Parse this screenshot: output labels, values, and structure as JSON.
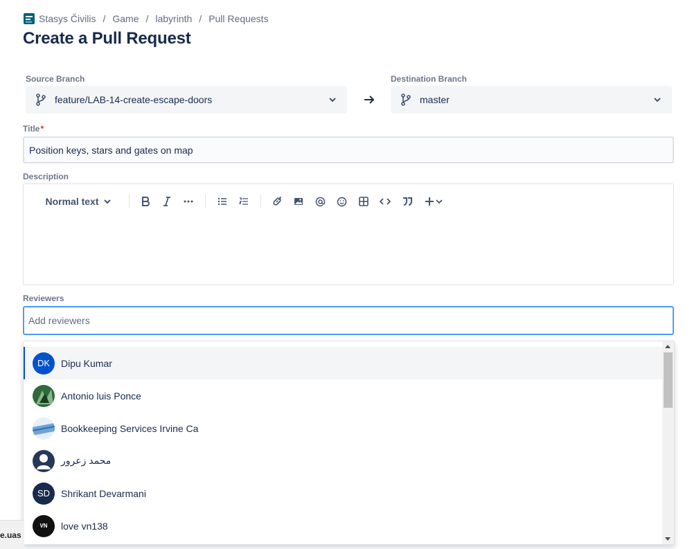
{
  "breadcrumb": {
    "items": [
      "Stasys Čivilis",
      "Game",
      "labyrinth",
      "Pull Requests"
    ],
    "separator": "/"
  },
  "page_title": "Create a Pull Request",
  "source_branch": {
    "label": "Source Branch",
    "value": "feature/LAB-14-create-escape-doors",
    "icon": "branch-icon"
  },
  "destination_branch": {
    "label": "Destination Branch",
    "value": "master",
    "icon": "branch-icon"
  },
  "title_field": {
    "label": "Title",
    "required_mark": "*",
    "value": "Position keys, stars and gates on map"
  },
  "description": {
    "label": "Description",
    "toolbar": {
      "text_style": "Normal text",
      "buttons": [
        "bold-icon",
        "italic-icon",
        "more-formatting-icon",
        "bullet-list-icon",
        "numbered-list-icon",
        "link-icon",
        "image-icon",
        "mention-icon",
        "emoji-icon",
        "table-icon",
        "code-icon",
        "quote-icon",
        "insert-more-icon"
      ]
    }
  },
  "reviewers": {
    "label": "Reviewers",
    "placeholder": "Add reviewers",
    "options": [
      {
        "name": "Dipu Kumar",
        "initials": "DK",
        "avatar_color": "#0052cc",
        "active": true
      },
      {
        "name": "Antonio luis Ponce",
        "initials": "",
        "avatar_color": "#2f6b3a"
      },
      {
        "name": "Bookkeeping Services Irvine Ca",
        "initials": "",
        "avatar_color": "#6fa3d8"
      },
      {
        "name": "محمد زعرور",
        "initials": "",
        "avatar_color": "#253858"
      },
      {
        "name": "Shrikant Devarmani",
        "initials": "SD",
        "avatar_color": "#172b4d"
      },
      {
        "name": "love vn138",
        "initials": "VN",
        "avatar_color": "#111111"
      }
    ]
  },
  "status_bar": {
    "url_text": "e.uas"
  },
  "colors": {
    "accent": "#0052cc",
    "focus_border": "#4c9aff",
    "required": "#de350b"
  }
}
